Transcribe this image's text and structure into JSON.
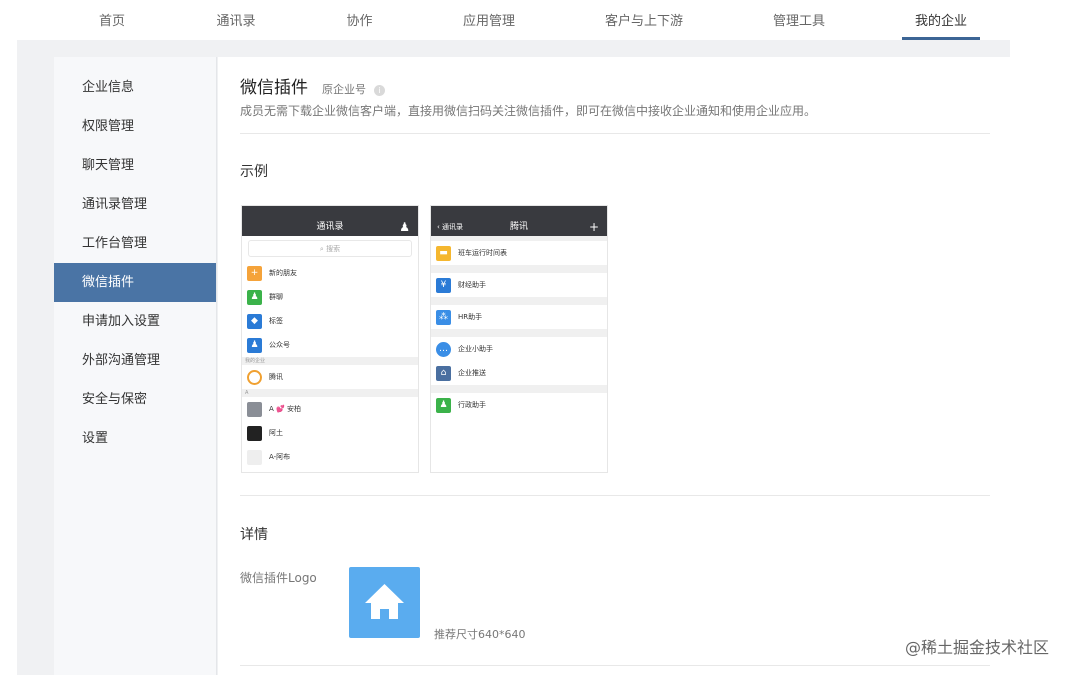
{
  "topnav": {
    "tabs": [
      "首页",
      "通讯录",
      "协作",
      "应用管理",
      "客户与上下游",
      "管理工具",
      "我的企业"
    ],
    "active": "我的企业"
  },
  "sidebar": {
    "items": [
      "企业信息",
      "权限管理",
      "聊天管理",
      "通讯录管理",
      "工作台管理",
      "微信插件",
      "申请加入设置",
      "外部沟通管理",
      "安全与保密",
      "设置"
    ],
    "active": "微信插件"
  },
  "main": {
    "title": "微信插件",
    "subtitle": "原企业号",
    "info_icon": "info-icon",
    "description": "成员无需下载企业微信客户端，直接用微信扫码关注微信插件，即可在微信中接收企业通知和使用企业应用。",
    "example_heading": "示例",
    "detail_heading": "详情",
    "logo_label": "微信插件Logo",
    "logo_icon": "home-icon",
    "logo_size": "推荐尺寸640*640"
  },
  "phone1": {
    "title": "通讯录",
    "search": "搜索",
    "rows": [
      {
        "label": "新的朋友",
        "color": "#f5a33a",
        "icon": "person-add-icon"
      },
      {
        "label": "群聊",
        "color": "#3bb24a",
        "icon": "group-icon"
      },
      {
        "label": "标签",
        "color": "#2b7bd6",
        "icon": "tag-icon"
      },
      {
        "label": "公众号",
        "color": "#2b7bd6",
        "icon": "person-icon"
      }
    ],
    "group1": "我的企业",
    "company": "腾讯",
    "group2": "A",
    "contacts": [
      "A 💕 安柏",
      "阿土",
      "A-阿布"
    ]
  },
  "phone2": {
    "back": "通讯录",
    "title": "腾讯",
    "rows": [
      {
        "label": "班车运行时间表",
        "color": "#f5b72f"
      },
      {
        "label": "财经助手",
        "color": "#2b7bd6"
      },
      {
        "label": "HR助手",
        "color": "#3a8ee6"
      },
      {
        "label": "企业小助手",
        "color": "#3a8ee6"
      },
      {
        "label": "企业推送",
        "color": "#4a6fa0"
      },
      {
        "label": "行政助手",
        "color": "#3bb24a"
      }
    ]
  },
  "watermark": "@稀土掘金技术社区"
}
